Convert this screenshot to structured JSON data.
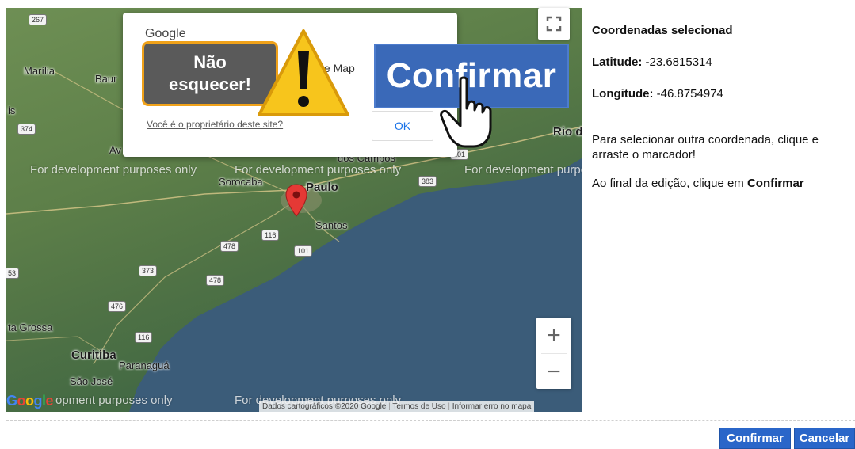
{
  "map": {
    "dev_watermark": "For development purposes only",
    "dev_partial_left": "opment purposes only",
    "cities": {
      "marilia": "Marília",
      "bauru": "Baur",
      "sorocaba": "Sorocaba",
      "sao_paulo": "Paulo",
      "santos": "Santos",
      "dos_campos": "dos Campos",
      "rio": "Rio d",
      "curitiba": "Curitiba",
      "paranagua": "Paranaguá",
      "sao_jose": "São José",
      "ponta_grossa": "ta Grossa",
      "av": "Av",
      "is": "is"
    },
    "shields": [
      "267",
      "374",
      "383",
      "101",
      "116",
      "478",
      "101",
      "373",
      "478",
      "476",
      "116",
      "53"
    ],
    "attribution": {
      "data": "Dados cartográficos ©2020 Google",
      "terms": "Termos de Uso",
      "report": "Informar erro no mapa"
    },
    "google_logo": "Google",
    "zoom_in": "+",
    "zoom_out": "−"
  },
  "dialog": {
    "google_title": "Google",
    "message_partial": "gle Map",
    "owner_link": "Você é o proprietário deste site?",
    "ok_label": "OK"
  },
  "overlay": {
    "reminder_line1": "Não",
    "reminder_line2": "esquecer!",
    "confirm_big": "Confirmar"
  },
  "panel": {
    "title": "Coordenadas selecionad",
    "lat_label": "Latitude:",
    "lat_value": " -23.6815314",
    "lng_label": "Longitude:",
    "lng_value": " -46.8754974",
    "instruction": "Para selecionar outra coordenada, clique e arraste o marcador!",
    "final_prefix": "Ao final da edição, clique em ",
    "final_bold": "Confirmar"
  },
  "footer": {
    "confirm_label": "Confirmar",
    "cancel_label": "Cancelar"
  },
  "colors": {
    "ocean": "#3b5c79",
    "land": "#5d7f49",
    "button_blue": "#2a66c9",
    "warning_yellow": "#f7c51c"
  }
}
